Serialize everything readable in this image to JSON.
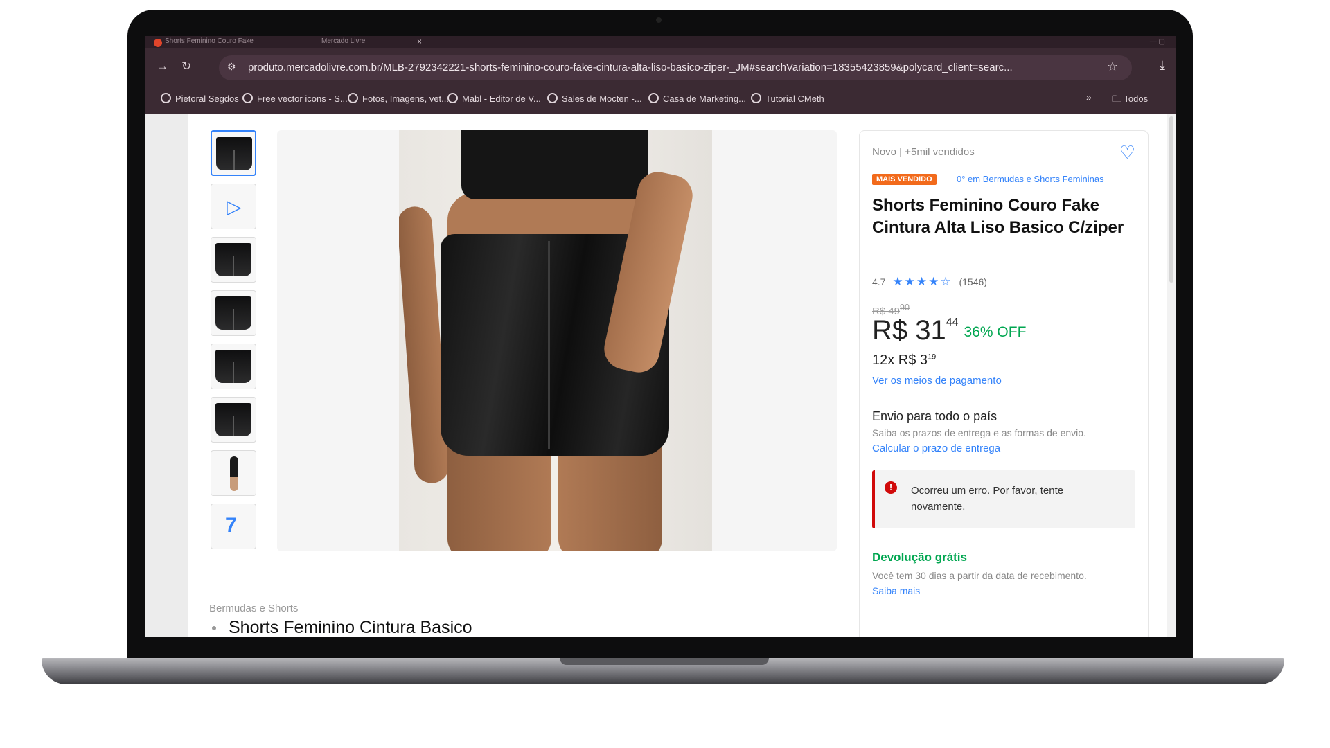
{
  "browser": {
    "tabs": [
      {
        "label": "Shorts Feminino Couro Fake"
      },
      {
        "label": "Mercado Livre"
      }
    ],
    "tab_close": "×",
    "url": "produto.mercadolivre.com.br/MLB-2792342221-shorts-feminino-couro-fake-cintura-alta-liso-basico-ziper-_JM#searchVariation=18355423859&polycard_client=searc...",
    "bookmarks": [
      {
        "label": "Pietoral Segdos"
      },
      {
        "label": "Free vector icons - S..."
      },
      {
        "label": "Fotos, Imagens, vet..."
      },
      {
        "label": "Mabl - Editor de V..."
      },
      {
        "label": "Sales de Mocten -..."
      },
      {
        "label": "Casa de Marketing..."
      },
      {
        "label": "Tutorial CMeth"
      }
    ],
    "bookmarks_more": "»",
    "bookmarks_folder": "Todos"
  },
  "product": {
    "meta": "Novo  |  +5mil vendidos",
    "badge": "MAIS VENDIDO",
    "badge_note": "0° em Bermudas e Shorts Femininas",
    "title": "Shorts Feminino Couro Fake Cintura Alta Liso Basico C/ziper",
    "rating_value": "4.7",
    "stars": "★★★★☆",
    "rating_count": "(1546)",
    "old_price": "R$ 49",
    "old_price_cents": "90",
    "price_main": "R$ 31",
    "price_cents": "44",
    "discount": "36% OFF",
    "installments_main": "12x R$ 3",
    "installments_cents": "19",
    "payment_link": "Ver os meios de pagamento",
    "shipping_title": "Envio para todo o país",
    "shipping_sub": "Saiba os prazos de entrega e as formas de envio.",
    "shipping_link": "Calcular o prazo de entrega",
    "error_text": "Ocorreu um erro. Por favor, tente novamente.",
    "return_title": "Devolução grátis",
    "return_sub": "Você tem 30 dias a partir da data de recebimento.",
    "return_link": "Saiba mais"
  },
  "page": {
    "breadcrumb": "Bermudas e Shorts",
    "bottom_title": "Shorts Feminino Cintura Basico"
  },
  "colors": {
    "accent": "#3483fa",
    "success": "#00a650",
    "error": "#d10a0a",
    "badge": "#f26a1b",
    "chrome": "#3b2a33"
  }
}
